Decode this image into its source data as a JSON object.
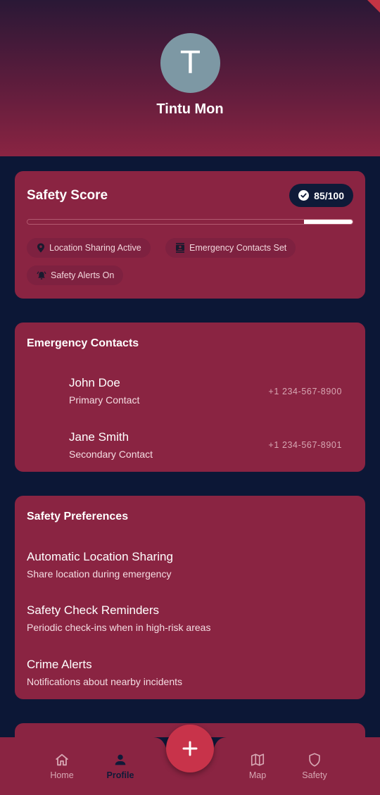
{
  "profile": {
    "avatar_initial": "T",
    "name": "Tintu Mon"
  },
  "safety_score": {
    "title": "Safety Score",
    "badge": "85/100",
    "progress_fraction": 0.85,
    "chips": [
      {
        "icon": "location-pin-icon",
        "label": "Location Sharing Active"
      },
      {
        "icon": "contacts-book-icon",
        "label": "Emergency Contacts Set"
      },
      {
        "icon": "alarm-bell-icon",
        "label": "Safety Alerts On"
      }
    ]
  },
  "emergency_contacts": {
    "title": "Emergency Contacts",
    "items": [
      {
        "name": "John Doe",
        "role": "Primary Contact",
        "phone": "+1 234-567-8900"
      },
      {
        "name": "Jane Smith",
        "role": "Secondary Contact",
        "phone": "+1 234-567-8901"
      }
    ]
  },
  "safety_preferences": {
    "title": "Safety Preferences",
    "items": [
      {
        "title": "Automatic Location Sharing",
        "subtitle": "Share location during emergency"
      },
      {
        "title": "Safety Check Reminders",
        "subtitle": "Periodic check-ins when in high-risk areas"
      },
      {
        "title": "Crime Alerts",
        "subtitle": "Notifications about nearby incidents"
      }
    ]
  },
  "bottom_nav": {
    "items": [
      {
        "label": "Home",
        "icon": "home-icon",
        "active": false
      },
      {
        "label": "Profile",
        "icon": "person-icon",
        "active": true
      },
      {
        "label": "Map",
        "icon": "map-icon",
        "active": false
      },
      {
        "label": "Safety",
        "icon": "shield-icon",
        "active": false
      }
    ],
    "fab_icon": "plus-icon"
  },
  "colors": {
    "background": "#0c1736",
    "card": "#8a2442",
    "accent": "#c8334a",
    "badge_bg": "#0f1a38"
  }
}
